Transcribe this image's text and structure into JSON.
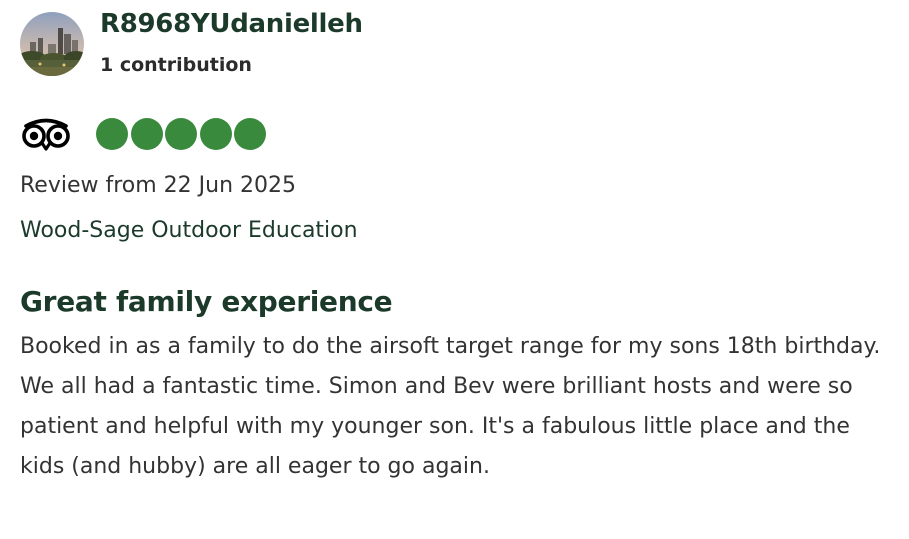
{
  "reviewer": {
    "avatar_icon": "user-avatar-photo",
    "username": "R8968YUdanielleh",
    "contributions": "1 contribution"
  },
  "rating": {
    "brand_icon": "tripadvisor-owl-icon",
    "bubbles_filled": 5,
    "bubbles_total": 5,
    "bubble_color": "#3a8a3e"
  },
  "review": {
    "date": "Review from 22 Jun 2025",
    "listing": "Wood-Sage Outdoor Education",
    "title": "Great family experience",
    "body": "Booked in as a family to do the airsoft target range for my sons 18th birthday. We all had a fantastic time. Simon and Bev were brilliant hosts and were so patient and helpful with my younger son. It's a fabulous little place and the kids (and hubby) are all eager to go again."
  },
  "colors": {
    "heading": "#1c3a2a",
    "text": "#333333"
  }
}
